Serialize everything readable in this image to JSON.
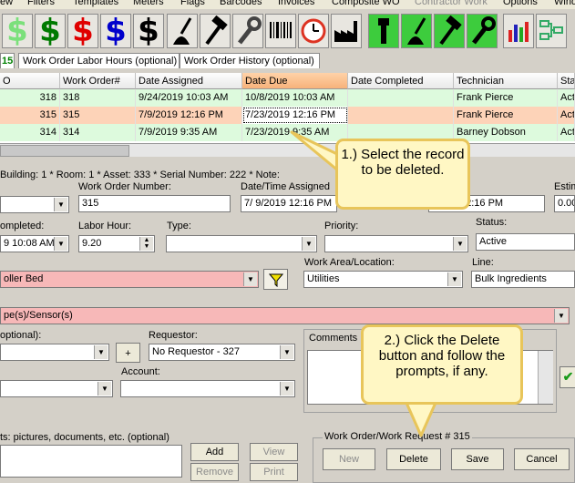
{
  "menu": [
    "ew",
    "Filters",
    "Templates",
    "Meters",
    "Flags",
    "Barcodes",
    "Invoices",
    "Composite WO",
    "Contractor Work",
    "Options",
    "Wind"
  ],
  "menu_disabled_index": 8,
  "toolbar": {
    "dollar_icons": [
      {
        "glyph": "$",
        "color": "#7be07b"
      },
      {
        "glyph": "$",
        "color": "#007a00"
      },
      {
        "glyph": "$",
        "color": "#e00000"
      },
      {
        "glyph": "$",
        "color": "#0000cc"
      },
      {
        "glyph": "$",
        "color": "#000000"
      }
    ]
  },
  "tabs": [
    "15",
    "Work Order Labor Hours (optional)",
    "Work Order History (optional)"
  ],
  "grid": {
    "headers": [
      "O",
      "Work Order#",
      "Date Assigned",
      "Date Due",
      "Date Completed",
      "Technician",
      "Sta"
    ],
    "rows": [
      [
        "318",
        "318",
        "9/24/2019 10:03 AM",
        "10/8/2019 10:03 AM",
        "",
        "Frank Pierce",
        "Act"
      ],
      [
        "315",
        "315",
        "7/9/2019 12:16 PM",
        "7/23/2019 12:16 PM",
        "",
        "Frank Pierce",
        "Act"
      ],
      [
        "314",
        "314",
        "7/9/2019 9:35 AM",
        "7/23/2019 9:35 AM",
        "",
        "Barney Dobson",
        "Act"
      ]
    ]
  },
  "form": {
    "info_line": "Building: 1 * Room: 1 * Asset: 333 * Serial Number: 222 * Note:",
    "work_order_number_label": "Work Order Number:",
    "work_order_number": "315",
    "date_time_assigned_label": "Date/Time Assigned",
    "date_assigned_value": "7/  9/2019 12:16 PM",
    "date_due_partial": "12:16 PM",
    "estim_label": "Estim",
    "estim_value": "0.00",
    "completed_label": "ompleted:",
    "completed_value": "9 10:08 AM",
    "labor_hour_label": "Labor Hour:",
    "labor_hour": "9.20",
    "type_label": "Type:",
    "priority_label": "Priority:",
    "status_label": "Status:",
    "status_value": "Active",
    "asset_value": "oller Bed",
    "work_area_label": "Work Area/Location:",
    "work_area_value": "Utilities",
    "line_label": "Line:",
    "line_value": "Bulk Ingredients",
    "task_value": "pe(s)/Sensor(s)",
    "optional_label": "optional):",
    "requestor_label": "Requestor:",
    "requestor_value": "No Requestor - 327",
    "account_label": "Account:",
    "comments_label": "Comments",
    "plus_label": "+",
    "attachments_label": "ts: pictures, documents, etc. (optional)",
    "add_label": "Add",
    "view_label": "View",
    "remove_label": "Remove",
    "print_label": "Print",
    "group_title": "Work Order/Work Request # 315",
    "new_label": "New",
    "delete_label": "Delete",
    "save_label": "Save",
    "cancel_label": "Cancel"
  },
  "callouts": {
    "one": "1.) Select the record to be deleted.",
    "two": "2.) Click the Delete button and follow the prompts, if any."
  }
}
